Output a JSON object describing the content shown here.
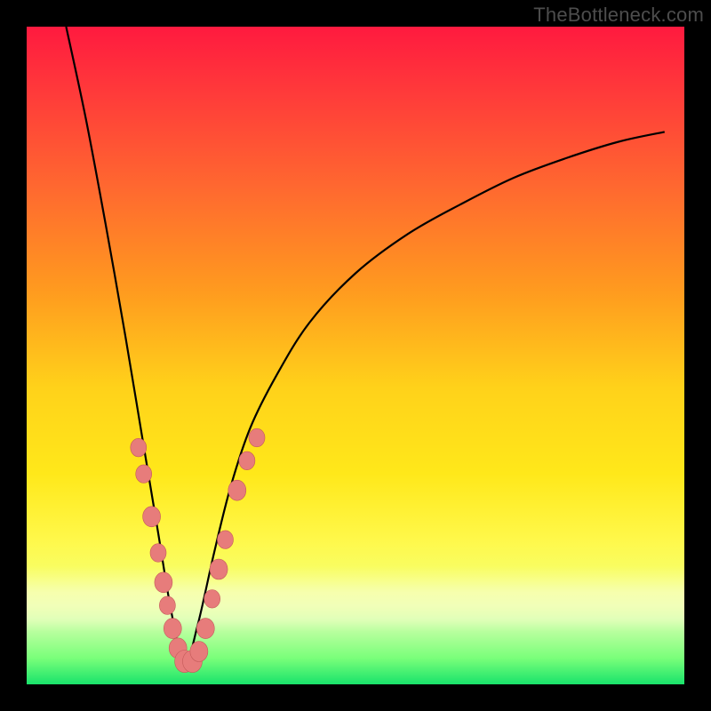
{
  "watermark": {
    "text": "TheBottleneck.com"
  },
  "chart_data": {
    "type": "line",
    "title": "",
    "xlabel": "",
    "ylabel": "",
    "xlim": [
      0,
      1
    ],
    "ylim": [
      0,
      1
    ],
    "annotations": [],
    "background": {
      "gradient_top_color": "#ff1a3f",
      "gradient_bottom_color": "#19e36b",
      "description": "vertical rainbow gradient red→orange→yellow→green"
    },
    "series": [
      {
        "name": "bottleneck-curve",
        "description": "V-shaped curve; steep fall on left, minimum near x≈0.24, asymptotic rise to right",
        "x": [
          0.06,
          0.09,
          0.12,
          0.15,
          0.175,
          0.2,
          0.22,
          0.24,
          0.26,
          0.285,
          0.31,
          0.34,
          0.38,
          0.43,
          0.5,
          0.58,
          0.66,
          0.74,
          0.82,
          0.9,
          0.97
        ],
        "y": [
          1.0,
          0.86,
          0.7,
          0.53,
          0.38,
          0.23,
          0.11,
          0.03,
          0.09,
          0.2,
          0.3,
          0.39,
          0.47,
          0.55,
          0.625,
          0.685,
          0.73,
          0.77,
          0.8,
          0.825,
          0.84
        ]
      }
    ],
    "markers": {
      "name": "highlighted-points",
      "color": "#e77c7b",
      "description": "salmon-colored circular markers clustered near the curve minimum",
      "points": [
        {
          "x": 0.17,
          "y": 0.36,
          "r": 9
        },
        {
          "x": 0.178,
          "y": 0.32,
          "r": 9
        },
        {
          "x": 0.19,
          "y": 0.255,
          "r": 10
        },
        {
          "x": 0.2,
          "y": 0.2,
          "r": 9
        },
        {
          "x": 0.208,
          "y": 0.155,
          "r": 10
        },
        {
          "x": 0.214,
          "y": 0.12,
          "r": 9
        },
        {
          "x": 0.222,
          "y": 0.085,
          "r": 10
        },
        {
          "x": 0.23,
          "y": 0.055,
          "r": 10
        },
        {
          "x": 0.24,
          "y": 0.035,
          "r": 11
        },
        {
          "x": 0.252,
          "y": 0.035,
          "r": 11
        },
        {
          "x": 0.262,
          "y": 0.05,
          "r": 10
        },
        {
          "x": 0.272,
          "y": 0.085,
          "r": 10
        },
        {
          "x": 0.282,
          "y": 0.13,
          "r": 9
        },
        {
          "x": 0.292,
          "y": 0.175,
          "r": 10
        },
        {
          "x": 0.302,
          "y": 0.22,
          "r": 9
        },
        {
          "x": 0.32,
          "y": 0.295,
          "r": 10
        },
        {
          "x": 0.335,
          "y": 0.34,
          "r": 9
        },
        {
          "x": 0.35,
          "y": 0.375,
          "r": 9
        }
      ]
    }
  }
}
